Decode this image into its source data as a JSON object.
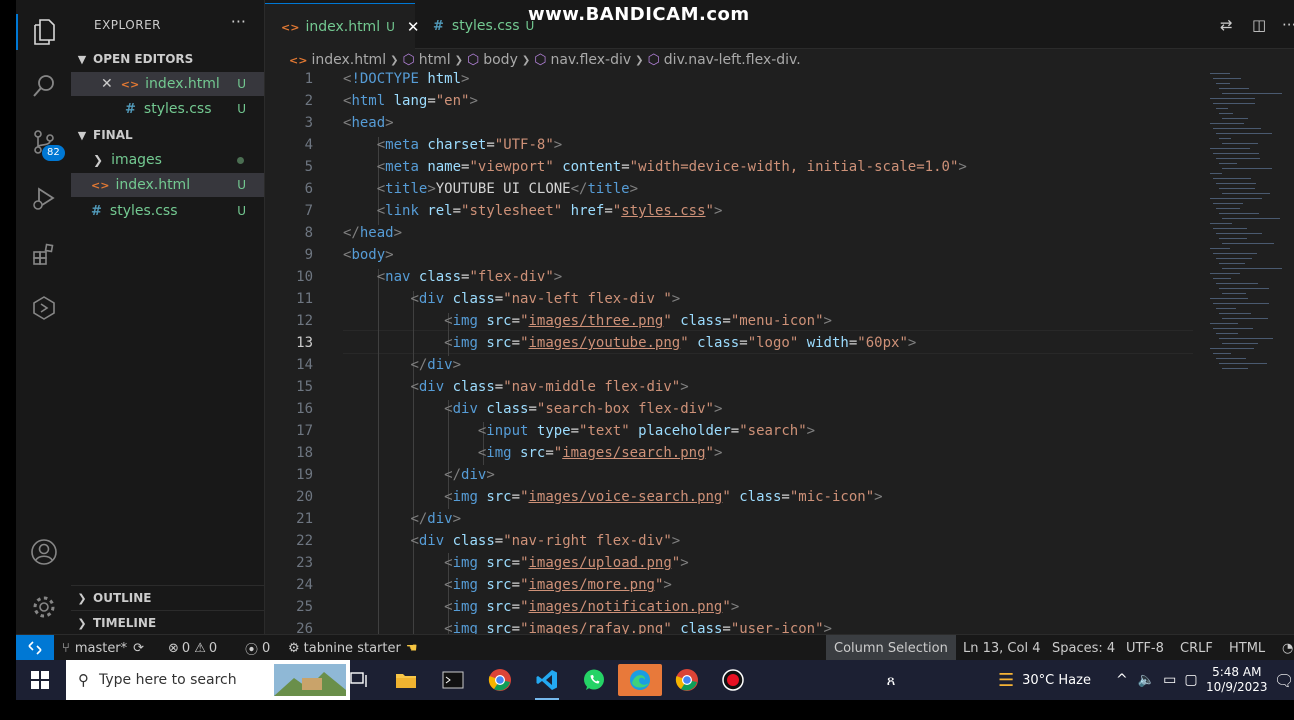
{
  "explorer": {
    "title": "EXPLORER",
    "more": "···",
    "open_editors_label": "OPEN EDITORS",
    "open_editors": [
      {
        "name": "index.html",
        "status": "U"
      },
      {
        "name": "styles.css",
        "status": "U"
      }
    ],
    "folder_label": "FINAL",
    "folder_items": [
      {
        "name": "images",
        "status": ""
      },
      {
        "name": "index.html",
        "status": "U"
      },
      {
        "name": "styles.css",
        "status": "U"
      }
    ],
    "outline_label": "OUTLINE",
    "timeline_label": "TIMELINE"
  },
  "activity": {
    "source_control_badge": "82"
  },
  "tabs": [
    {
      "label": "index.html",
      "status": "U"
    },
    {
      "label": "styles.css",
      "status": "U"
    }
  ],
  "watermark": "www.BANDICAM.com",
  "breadcrumb": [
    "index.html",
    "html",
    "body",
    "nav.flex-div",
    "div.nav-left.flex-div."
  ],
  "editor": {
    "current_line": "13",
    "line_numbers": [
      "1",
      "2",
      "3",
      "4",
      "5",
      "6",
      "7",
      "8",
      "9",
      "10",
      "11",
      "12",
      "13",
      "14",
      "15",
      "16",
      "17",
      "18",
      "19",
      "20",
      "21",
      "22",
      "23",
      "24",
      "25",
      "26"
    ]
  },
  "status": {
    "branch": "master*",
    "errors": "0",
    "warnings": "0",
    "ports": "0",
    "tabnine": "tabnine starter",
    "mode": "Column Selection",
    "position": "Ln 13, Col 4",
    "spaces": "Spaces: 4",
    "encoding": "UTF-8",
    "eol": "CRLF",
    "language": "HTML"
  },
  "taskbar": {
    "search_placeholder": "Type here to search",
    "weather": "30°C  Haze",
    "time": "5:48 AM",
    "date": "10/9/2023"
  }
}
